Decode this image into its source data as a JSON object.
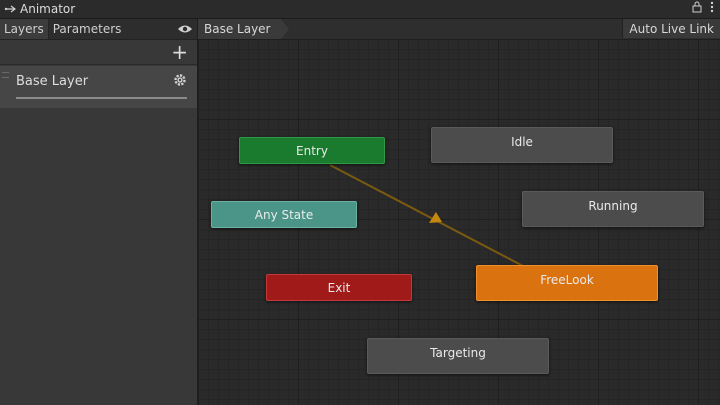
{
  "window": {
    "title": "Animator"
  },
  "left_panel": {
    "tabs": [
      {
        "label": "Layers"
      },
      {
        "label": "Parameters"
      }
    ],
    "layers": [
      {
        "name": "Base Layer"
      }
    ]
  },
  "graph": {
    "breadcrumb": "Base Layer",
    "auto_live_link": "Auto Live Link",
    "nodes": {
      "entry": "Entry",
      "any_state": "Any State",
      "exit": "Exit",
      "idle": "Idle",
      "running": "Running",
      "freelook": "FreeLook",
      "targeting": "Targeting"
    },
    "transitions": [
      {
        "from": "Entry",
        "to": "FreeLook"
      }
    ]
  },
  "colors": {
    "entry": "#1a7a2e",
    "any_state": "#4b9588",
    "exit": "#a11a1a",
    "default_state": "#d9720f",
    "state": "#4c4c4c",
    "transition": "#7a5a10"
  }
}
